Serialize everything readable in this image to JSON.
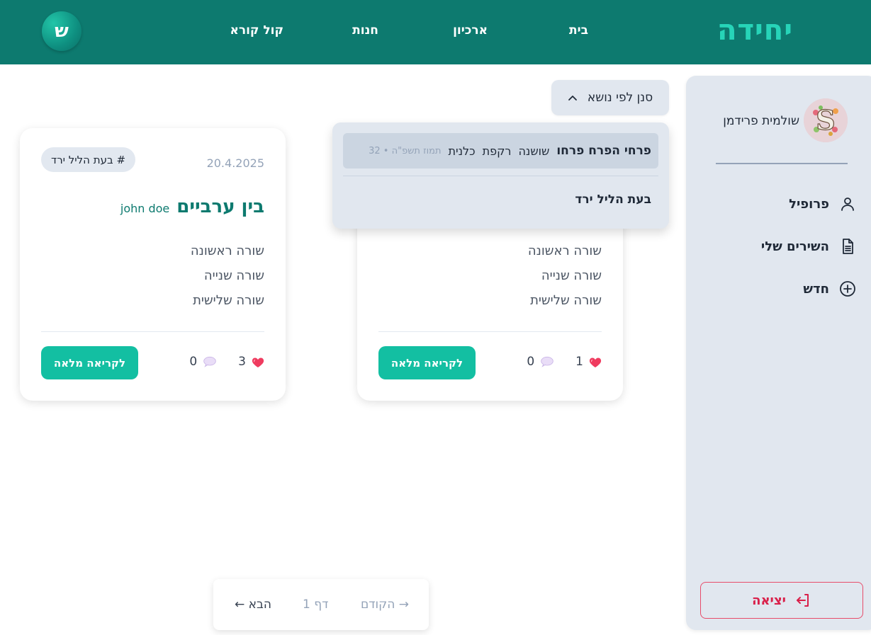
{
  "header": {
    "brand": "יחידה",
    "nav": {
      "home": "בית",
      "archive": "ארכיון",
      "shop": "חנות",
      "kol_kore": "קול קורא"
    },
    "avatar_letter": "ש"
  },
  "sidebar": {
    "user_name": "שולמית פרידמן",
    "profile_letter": "S",
    "items": [
      {
        "label": "פרופיל",
        "icon": "user-icon"
      },
      {
        "label": "השירים שלי",
        "icon": "document-icon"
      },
      {
        "label": "חדש",
        "icon": "plus-circle-icon"
      }
    ],
    "logout": "יציאה"
  },
  "filter": {
    "label": "סנן לפי נושא"
  },
  "dropdown": {
    "item1": {
      "title": "פרחי הפרח פרחו",
      "tags": [
        "שושנה",
        "רקפת",
        "כלנית"
      ],
      "meta": "תמוז תשפ\"ה • 32"
    },
    "item2": {
      "title": "בעת הליל ירד"
    }
  },
  "cards": [
    {
      "date": "20.4.2025",
      "tag": "# בעת הליל ירד",
      "title": "בין ערביים",
      "author": "john doe",
      "lines": [
        "שורה ראשונה",
        "שורה שנייה",
        "שורה שלישית"
      ],
      "likes": "3",
      "comments": "0",
      "read_more": "לקריאה מלאה"
    },
    {
      "lines": [
        "שורה ראשונה",
        "שורה שנייה",
        "שורה שלישית"
      ],
      "likes": "1",
      "comments": "0",
      "read_more": "לקריאה מלאה"
    }
  ],
  "pagination": {
    "prev": "→ הקודם",
    "page": "דף 1",
    "next": "הבא ←"
  },
  "colors": {
    "header_bg": "#0d7a6f",
    "brand": "#27d4b8",
    "accent_button": "#13bfa2",
    "sidebar_bg": "#e1e7ef",
    "logout": "#d9204a"
  }
}
